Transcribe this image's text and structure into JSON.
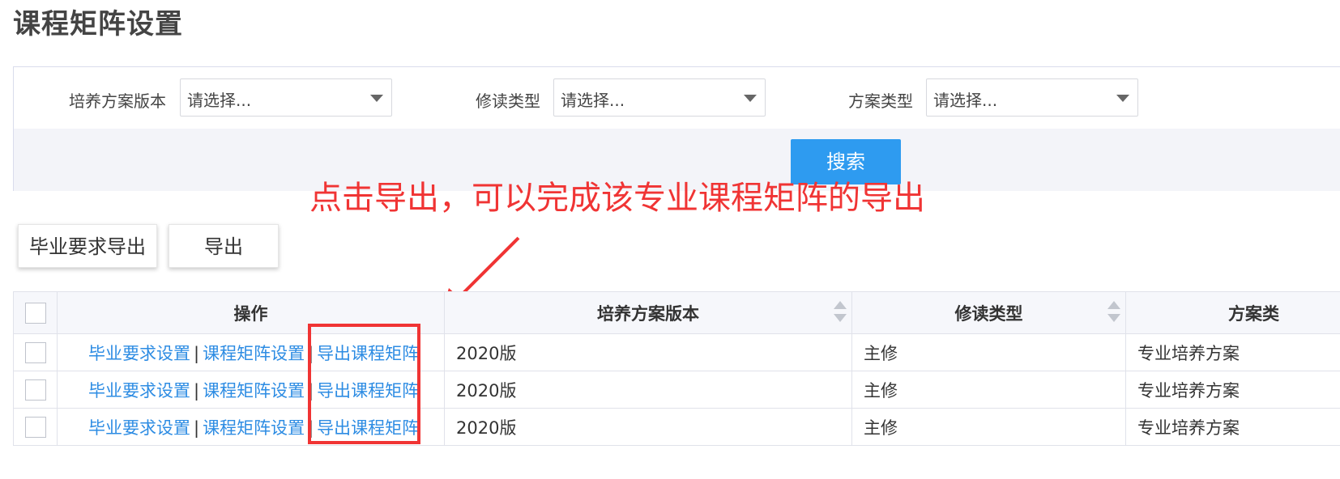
{
  "page": {
    "title": "课程矩阵设置"
  },
  "filters": {
    "version": {
      "label": "培养方案版本",
      "value": "请选择..."
    },
    "study_type": {
      "label": "修读类型",
      "value": "请选择..."
    },
    "plan_type": {
      "label": "方案类型",
      "value": "请选择..."
    },
    "search_label": "搜索"
  },
  "annotation": {
    "text": "点击导出，可以完成该专业课程矩阵的导出",
    "color": "#f03434"
  },
  "toolbar": {
    "grad_export_label": "毕业要求导出",
    "export_label": "导出"
  },
  "table": {
    "headers": {
      "ops": "操作",
      "version": "培养方案版本",
      "study_type": "修读类型",
      "plan_type": "方案类"
    },
    "rows": [
      {
        "op1": "毕业要求设置",
        "op2": "课程矩阵设置",
        "op3": "导出课程矩阵",
        "sep": "|",
        "version": "2020版",
        "study_type": "主修",
        "plan_type": "专业培养方案"
      },
      {
        "op1": "毕业要求设置",
        "op2": "课程矩阵设置",
        "op3": "导出课程矩阵",
        "sep": "|",
        "version": "2020版",
        "study_type": "主修",
        "plan_type": "专业培养方案"
      },
      {
        "op1": "毕业要求设置",
        "op2": "课程矩阵设置",
        "op3": "导出课程矩阵",
        "sep": "|",
        "version": "2020版",
        "study_type": "主修",
        "plan_type": "专业培养方案"
      }
    ]
  },
  "colors": {
    "link": "#2d8ce3",
    "primary": "#2e9bf0",
    "annotation": "#f03434"
  }
}
